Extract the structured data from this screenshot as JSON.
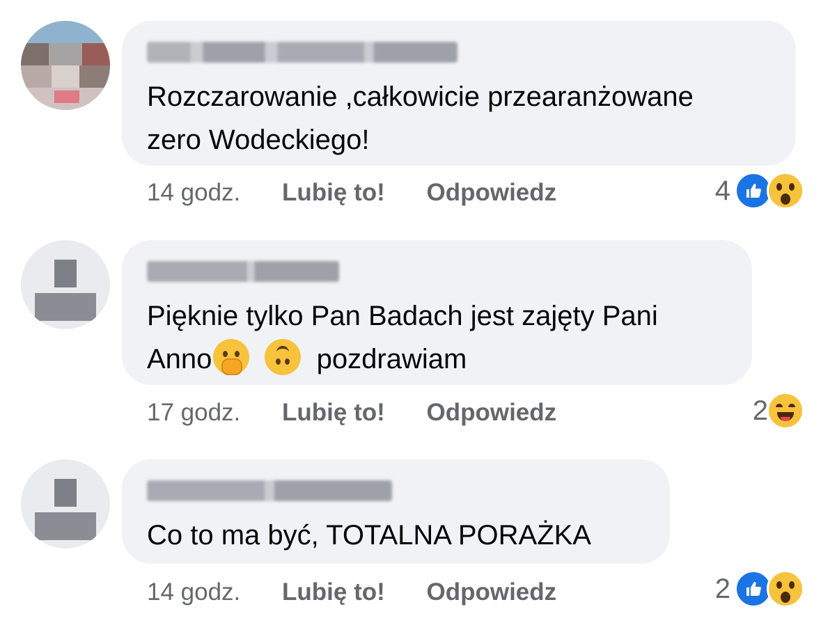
{
  "comments": [
    {
      "text_lines": [
        "Rozczarowanie ,całkowicie przearanżowane",
        "zero Wodeckiego!"
      ],
      "time": "14 godz.",
      "like_label": "Lubię to!",
      "reply_label": "Odpowiedz",
      "reaction_count": "4",
      "reactions": [
        "like-icon",
        "wow-icon"
      ]
    },
    {
      "text_line1": "Pięknie tylko Pan Badach jest zajęty Pani",
      "text_line2_before": "Anno",
      "text_line2_emojis": [
        "face-with-hand-over-mouth-emoji",
        "upside-down-face-emoji"
      ],
      "text_line2_after": "pozdrawiam",
      "time": "17 godz.",
      "like_label": "Lubię to!",
      "reply_label": "Odpowiedz",
      "reaction_count": "2",
      "reactions": [
        "haha-icon"
      ]
    },
    {
      "text_lines": [
        "Co to ma być, TOTALNA PORAŻKA"
      ],
      "time": "14 godz.",
      "like_label": "Lubię to!",
      "reply_label": "Odpowiedz",
      "reaction_count": "2",
      "reactions": [
        "like-icon",
        "wow-icon"
      ]
    }
  ],
  "colors": {
    "bubble": "#f0f2f5",
    "secondary_text": "#65676b",
    "like_blue": "#1b74e4",
    "emoji_yellow": "#f7c23c"
  }
}
